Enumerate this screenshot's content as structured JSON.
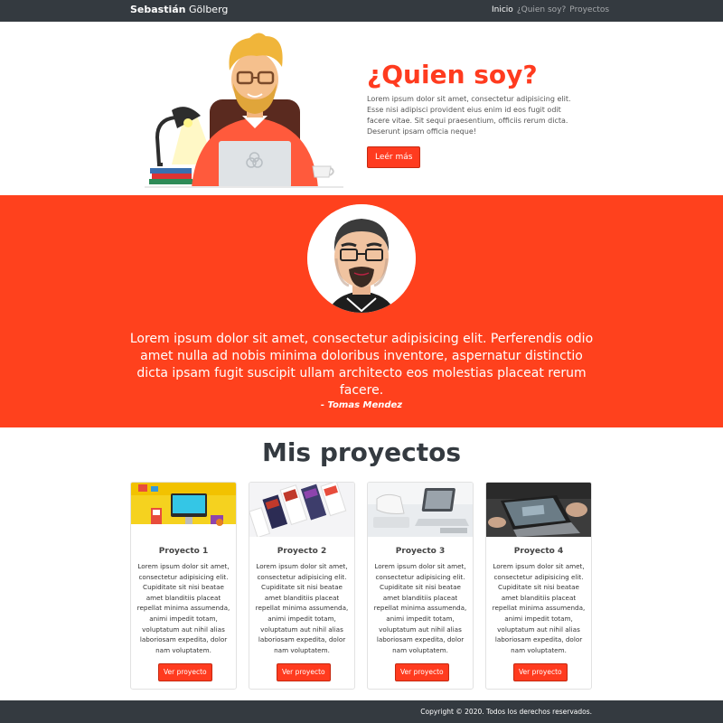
{
  "navbar": {
    "brand_bold": "Sebastián",
    "brand_rest": "Gölberg",
    "links": [
      "Inicio",
      "¿Quien soy?",
      "Proyectos"
    ],
    "active_link": "Inicio"
  },
  "hero": {
    "title": "¿Quien soy?",
    "description": "Lorem ipsum dolor sit amet, consectetur adipisicing elit. Esse nisi adipisci provident eius enim id eos fugit odit facere vitae. Sit sequi praesentium, officiis rerum dicta. Deserunt ipsam officia neque!",
    "button": "Leér más"
  },
  "testimonial": {
    "quote": "Lorem ipsum dolor sit amet, consectetur adipisicing elit. Perferendis odio amet nulla ad nobis minima doloribus inventore, aspernatur distinctio dicta ipsam fugit suscipit ullam architecto eos molestias placeat rerum facere.",
    "author": "- Tomas Mendez"
  },
  "projects": {
    "title": "Mis proyectos",
    "items": [
      {
        "title": "Proyecto 1",
        "text": "Lorem ipsum dolor sit amet, consectetur adipisicing elit. Cupiditate sit nisi beatae amet blanditiis placeat repellat minima assumenda, animi impedit totam, voluptatum aut nihil alias laboriosam expedita, dolor nam voluptatem.",
        "button": "Ver proyecto"
      },
      {
        "title": "Proyecto 2",
        "text": "Lorem ipsum dolor sit amet, consectetur adipisicing elit. Cupiditate sit nisi beatae amet blanditiis placeat repellat minima assumenda, animi impedit totam, voluptatum aut nihil alias laboriosam expedita, dolor nam voluptatem.",
        "button": "Ver proyecto"
      },
      {
        "title": "Proyecto 3",
        "text": "Lorem ipsum dolor sit amet, consectetur adipisicing elit. Cupiditate sit nisi beatae amet blanditiis placeat repellat minima assumenda, animi impedit totam, voluptatum aut nihil alias laboriosam expedita, dolor nam voluptatem.",
        "button": "Ver proyecto"
      },
      {
        "title": "Proyecto 4",
        "text": "Lorem ipsum dolor sit amet, consectetur adipisicing elit. Cupiditate sit nisi beatae amet blanditiis placeat repellat minima assumenda, animi impedit totam, voluptatum aut nihil alias laboriosam expedita, dolor nam voluptatem.",
        "button": "Ver proyecto"
      }
    ]
  },
  "footer": {
    "text": "Copyright © 2020. Todos los derechos reservados."
  },
  "colors": {
    "accent": "#ff3b1f",
    "navbar": "#343a40",
    "testimonial_bg": "#ff411d"
  }
}
